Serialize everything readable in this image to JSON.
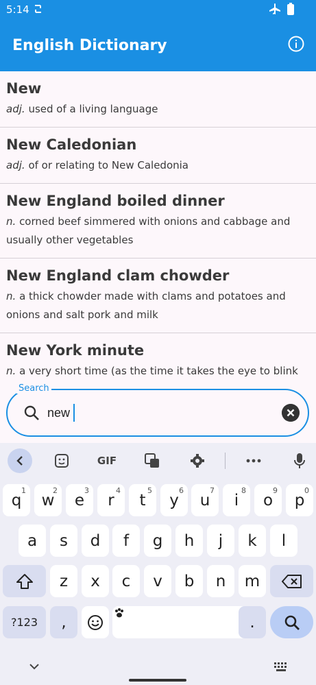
{
  "status": {
    "time": "5:14"
  },
  "app": {
    "title": "English Dictionary"
  },
  "entries": [
    {
      "word": "New",
      "pos": "adj.",
      "definition": "used of a living language"
    },
    {
      "word": "New Caledonian",
      "pos": "adj.",
      "definition": "of or relating to New Caledonia"
    },
    {
      "word": "New England boiled dinner",
      "pos": "n.",
      "definition": "corned beef simmered with onions and cabbage and usually other vegetables"
    },
    {
      "word": "New England clam chowder",
      "pos": "n.",
      "definition": "a thick chowder made with clams and potatoes and onions and salt pork and milk"
    },
    {
      "word": "New York minute",
      "pos": "n.",
      "definition": "a very short time (as the time it takes the eye to blink or"
    }
  ],
  "search": {
    "label": "Search",
    "value": "new"
  },
  "keyboard": {
    "toolbar": {
      "gif": "GIF"
    },
    "row1": [
      {
        "key": "q",
        "hint": "1"
      },
      {
        "key": "w",
        "hint": "2"
      },
      {
        "key": "e",
        "hint": "3"
      },
      {
        "key": "r",
        "hint": "4"
      },
      {
        "key": "t",
        "hint": "5"
      },
      {
        "key": "y",
        "hint": "6"
      },
      {
        "key": "u",
        "hint": "7"
      },
      {
        "key": "i",
        "hint": "8"
      },
      {
        "key": "o",
        "hint": "9"
      },
      {
        "key": "p",
        "hint": "0"
      }
    ],
    "row2": [
      "a",
      "s",
      "d",
      "f",
      "g",
      "h",
      "j",
      "k",
      "l"
    ],
    "row3": [
      "z",
      "x",
      "c",
      "v",
      "b",
      "n",
      "m"
    ],
    "symbols": "?123",
    "comma": ",",
    "period": "."
  }
}
